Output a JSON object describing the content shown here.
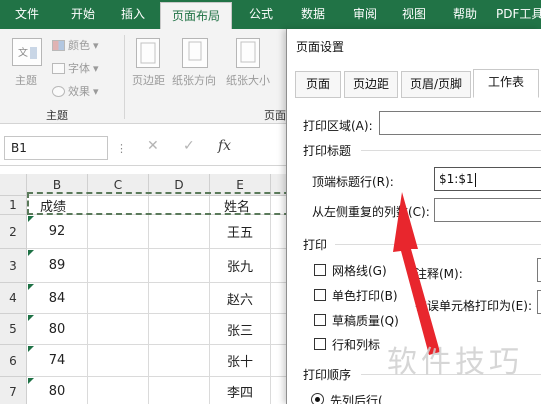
{
  "ribbon_tabs": [
    "文件",
    "开始",
    "插入",
    "页面布局",
    "公式",
    "数据",
    "审阅",
    "视图",
    "帮助",
    "PDF工具"
  ],
  "active_tab": "页面布局",
  "ribbon": {
    "theme_label": "主题",
    "colors_label": "颜色",
    "fonts_label": "字体",
    "effects_label": "效果",
    "margins_label": "页边距",
    "orientation_label": "纸张方向",
    "size_label": "纸张大小",
    "group_theme": "主题",
    "group_page": "页面"
  },
  "formula_bar": {
    "name_box": "B1",
    "cancel": "✕",
    "enter": "✓",
    "fx": "fx"
  },
  "grid": {
    "columns": [
      "B",
      "C",
      "D",
      "E"
    ],
    "rows": [
      {
        "num": "1",
        "b": "成绩",
        "e": "姓名"
      },
      {
        "num": "2",
        "b": "92",
        "e": "王五"
      },
      {
        "num": "3",
        "b": "89",
        "e": "张九"
      },
      {
        "num": "4",
        "b": "84",
        "e": "赵六"
      },
      {
        "num": "5",
        "b": "80",
        "e": "张三"
      },
      {
        "num": "6",
        "b": "74",
        "e": "张十"
      },
      {
        "num": "7",
        "b": "80",
        "e": "李四"
      }
    ]
  },
  "dialog": {
    "title": "页面设置",
    "tabs": [
      "页面",
      "页边距",
      "页眉/页脚",
      "工作表"
    ],
    "active_tab": "工作表",
    "print_area_label": "打印区域(A):",
    "print_titles_label": "打印标题",
    "top_rows_label": "顶端标题行(R):",
    "top_rows_value": "$1:$1",
    "left_cols_label": "从左侧重复的列数(C):",
    "print_section": "打印",
    "gridlines": "网格线(G)",
    "bw": "单色打印(B)",
    "draft": "草稿质量(Q)",
    "rowcol": "行和列标",
    "comments_label": "注释(M):",
    "errors_label": "错误单元格打印为(E):",
    "order_section": "打印顺序",
    "order_option": "先列后行("
  },
  "watermark": "软件技巧",
  "colors": {
    "ribbon_green": "#217346",
    "arrow_red": "#e8262d",
    "marker_green": "#1e7145"
  }
}
